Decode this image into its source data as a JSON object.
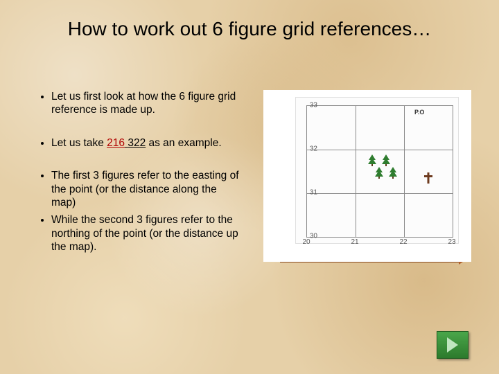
{
  "title": "How to work out 6 figure grid references…",
  "bullets": {
    "b1": "Let us first look at how the 6 figure grid reference is made up.",
    "b2_pre": "Let us take ",
    "b2_e": "216",
    "b2_sp": "  ",
    "b2_n": "322",
    "b2_post": " as an example.",
    "b3": "The first 3 figures  refer to the easting of the point (or the distance along the map)",
    "b4": "While the second 3 figures refer to the northing of the point (or the distance up the map)."
  },
  "grid": {
    "po_label": "P.O",
    "y_ticks": [
      "33",
      "32",
      "31",
      "30"
    ],
    "x_ticks": [
      "20",
      "21",
      "22",
      "23"
    ]
  },
  "nav": {
    "next_label": "Next"
  }
}
